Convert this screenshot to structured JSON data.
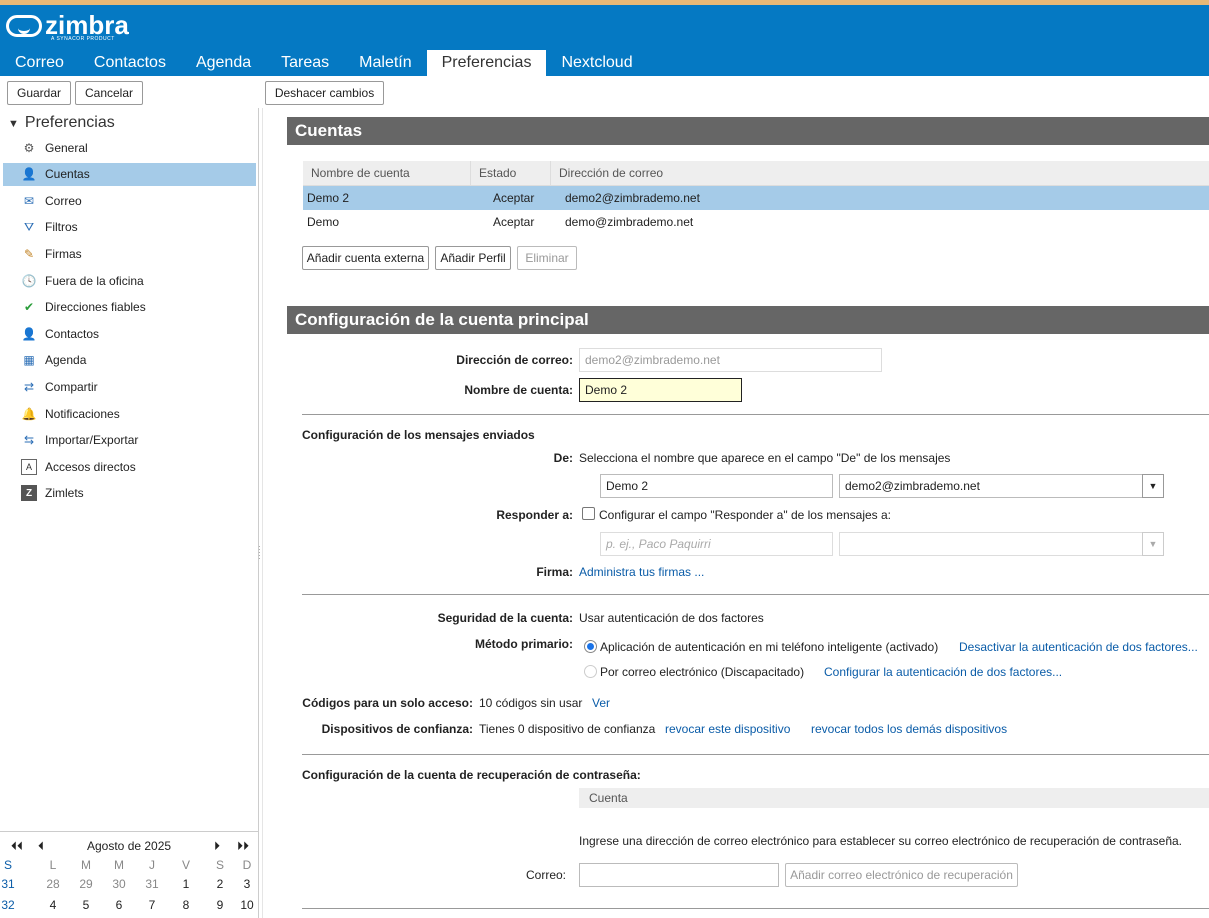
{
  "header": {
    "logo_text": "zimbra",
    "logo_sub": "A SYNACOR PRODUCT",
    "tabs": [
      "Correo",
      "Contactos",
      "Agenda",
      "Tareas",
      "Maletín",
      "Preferencias",
      "Nextcloud"
    ],
    "active_tab": "Preferencias"
  },
  "toolbar": {
    "save": "Guardar",
    "cancel": "Cancelar",
    "undo": "Deshacer cambios"
  },
  "sidebar": {
    "title": "Preferencias",
    "items": [
      {
        "label": "General",
        "icon": "gear-icon"
      },
      {
        "label": "Cuentas",
        "icon": "accounts-icon"
      },
      {
        "label": "Correo",
        "icon": "envelope-icon"
      },
      {
        "label": "Filtros",
        "icon": "filter-icon"
      },
      {
        "label": "Firmas",
        "icon": "signature-icon"
      },
      {
        "label": "Fuera de la oficina",
        "icon": "out-of-office-icon"
      },
      {
        "label": "Direcciones fiables",
        "icon": "shield-check-icon"
      },
      {
        "label": "Contactos",
        "icon": "contact-icon"
      },
      {
        "label": "Agenda",
        "icon": "calendar-icon"
      },
      {
        "label": "Compartir",
        "icon": "share-icon"
      },
      {
        "label": "Notificaciones",
        "icon": "bell-icon"
      },
      {
        "label": "Importar/Exportar",
        "icon": "import-export-icon"
      },
      {
        "label": "Accesos directos",
        "icon": "shortcut-icon"
      },
      {
        "label": "Zimlets",
        "icon": "zimlet-icon"
      }
    ],
    "selected": "Cuentas"
  },
  "calendar": {
    "month": "Agosto de 2025",
    "weekday_headers": [
      "S",
      "L",
      "M",
      "M",
      "J",
      "V",
      "S",
      "D"
    ],
    "rows": [
      [
        "31",
        "28",
        "29",
        "30",
        "31",
        "1",
        "2",
        "3"
      ],
      [
        "32",
        "4",
        "5",
        "6",
        "7",
        "8",
        "9",
        "10"
      ]
    ]
  },
  "accounts": {
    "title": "Cuentas",
    "columns": [
      "Nombre de cuenta",
      "Estado",
      "Dirección de correo"
    ],
    "rows": [
      {
        "name": "Demo 2",
        "state": "Aceptar",
        "email": "demo2@zimbrademo.net"
      },
      {
        "name": "Demo",
        "state": "Aceptar",
        "email": "demo@zimbrademo.net"
      }
    ],
    "add_external": "Añadir cuenta externa",
    "add_profile": "Añadir Perfil",
    "delete": "Eliminar"
  },
  "main_config": {
    "title": "Configuración de la cuenta principal",
    "email_label": "Dirección de correo:",
    "email_value": "demo2@zimbrademo.net",
    "name_label": "Nombre de cuenta:",
    "name_value": "Demo 2",
    "sent_title": "Configuración de los mensajes enviados",
    "from_label": "De:",
    "from_desc": "Selecciona el nombre que aparece en el campo \"De\" de los mensajes",
    "from_name": "Demo 2",
    "from_email": "demo2@zimbrademo.net",
    "reply_label": "Responder a:",
    "reply_desc": "Configurar el campo \"Responder a\" de los mensajes a:",
    "reply_placeholder": "p. ej., Paco Paquirri",
    "signature_label": "Firma:",
    "signature_link": "Administra tus firmas ...",
    "security_label": "Seguridad de la cuenta:",
    "security_value": "Usar autenticación de dos factores",
    "primary_label": "Método primario:",
    "method_app": "Aplicación de autenticación en mi teléfono inteligente (activado)",
    "method_app_link": "Desactivar la autenticación de dos factores...",
    "method_email": "Por correo electrónico (Discapacitado)",
    "method_email_link": "Configurar la autenticación de dos factores...",
    "codes_label": "Códigos para un solo acceso:",
    "codes_value": "10 códigos sin usar",
    "codes_link": "Ver",
    "devices_label": "Dispositivos de confianza:",
    "devices_value": "Tienes 0 dispositivo de confianza",
    "revoke_this": "revocar este dispositivo",
    "revoke_all": "revocar todos los demás dispositivos",
    "recovery_title": "Configuración de la cuenta de recuperación de contraseña:",
    "recovery_column": "Cuenta",
    "recovery_desc": "Ingrese una dirección de correo electrónico para establecer su correo electrónico de recuperación de contraseña.",
    "recovery_email_label": "Correo:",
    "recovery_button": "Añadir correo electrónico de recuperación"
  }
}
